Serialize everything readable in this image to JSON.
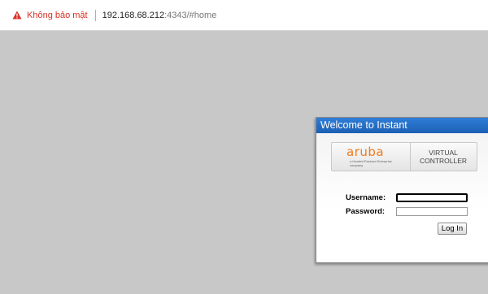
{
  "browser": {
    "security_label": "Không bảo mật",
    "url_host": "192.168.68.212",
    "url_rest": ":4343/#home",
    "warning_icon": "warning-triangle-icon",
    "warning_color": "#d93025"
  },
  "dialog": {
    "title": "Welcome to Instant",
    "title_bar_color": "#1f6ec0",
    "logo": {
      "brand": "aruba",
      "tagline": "a Hewlett Packard Enterprise company",
      "brand_color": "#f07a1a",
      "product_line1": "VIRTUAL",
      "product_line2": "CONTROLLER"
    },
    "username_label": "Username:",
    "password_label": "Password:",
    "username_value": "",
    "password_value": "",
    "login_button": "Log In"
  }
}
